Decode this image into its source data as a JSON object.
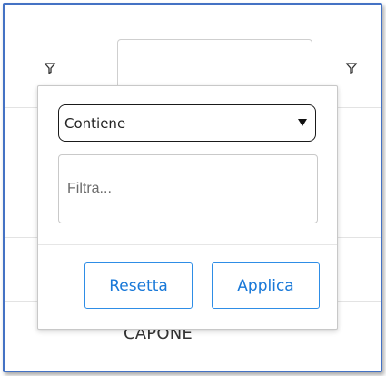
{
  "grid": {
    "header_filter_icon_1": "filter-funnel-icon",
    "header_filter_icon_2": "filter-funnel-icon",
    "visible_cell_value": "CAPONE"
  },
  "filter_popup": {
    "operator_selected": "Contiene",
    "value_placeholder": "Filtra...",
    "reset_label": "Resetta",
    "apply_label": "Applica"
  },
  "colors": {
    "frame_border": "#4472c4",
    "button_accent": "#1878d8"
  }
}
